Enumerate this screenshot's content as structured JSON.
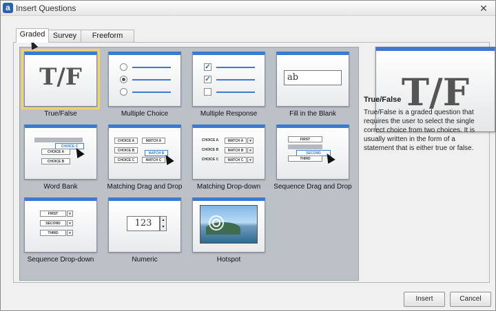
{
  "window": {
    "title": "Insert Questions",
    "app_icon": "a",
    "close_glyph": "✕"
  },
  "tabs": [
    {
      "label": "Graded",
      "active": true
    },
    {
      "label": "Survey",
      "active": false
    },
    {
      "label": "Freeform",
      "active": false
    }
  ],
  "question_types": [
    {
      "label": "True/False",
      "thumb_text": "T/F",
      "selected": true
    },
    {
      "label": "Multiple Choice"
    },
    {
      "label": "Multiple Response",
      "check": "✓"
    },
    {
      "label": "Fill in the Blank",
      "thumb_text": "ab"
    },
    {
      "label": "Word Bank",
      "chips": [
        "CHOICE C",
        "CHOICE A",
        "CHOICE B"
      ]
    },
    {
      "label": "Matching Drag and Drop",
      "chips": [
        "CHOICE A",
        "CHOICE B",
        "CHOICE C",
        "MATCH A",
        "MATCH B",
        "MATCH C"
      ]
    },
    {
      "label": "Matching Drop-down",
      "chips": [
        "CHOICE A",
        "CHOICE B",
        "CHOICE C",
        "MATCH A",
        "MATCH B",
        "MATCH C"
      ]
    },
    {
      "label": "Sequence Drag and Drop",
      "chips": [
        "FIRST",
        "SECOND",
        "THIRD"
      ]
    },
    {
      "label": "Sequence Drop-down",
      "chips": [
        "FIRST",
        "SECOND",
        "THIRD"
      ]
    },
    {
      "label": "Numeric",
      "thumb_text": "123"
    },
    {
      "label": "Hotspot"
    }
  ],
  "preview": {
    "thumb_text": "T/F",
    "title": "True/False",
    "description": "True/False is a graded question that requires the user to select the single correct choice from two choices.  It is usually written in the form of a statement that is either true or false."
  },
  "buttons": {
    "insert": "Insert",
    "cancel": "Cancel"
  },
  "glyphs": {
    "dropdown": "▾",
    "spin_up": "▴",
    "spin_down": "▾"
  },
  "colors": {
    "accent": "#3a7ad0",
    "selection": "#f1d36b"
  }
}
